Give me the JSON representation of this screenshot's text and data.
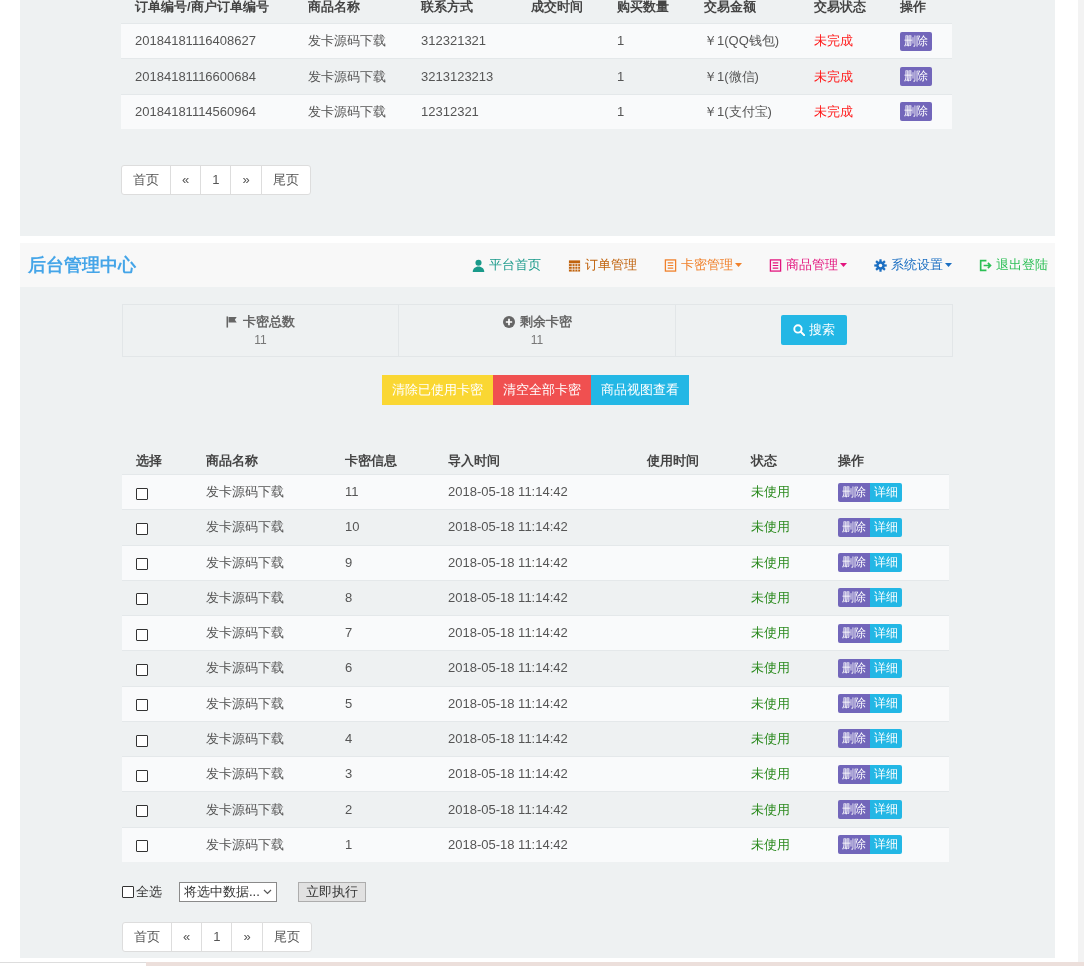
{
  "orders_table": {
    "columns": [
      "订单编号/商户订单编号",
      "商品名称",
      "联系方式",
      "成交时间",
      "购买数量",
      "交易金额",
      "交易状态",
      "操作"
    ],
    "rows": [
      {
        "order_no": "20184181116408627",
        "product": "发卡源码下载",
        "contact": "312321321",
        "quantity": "1",
        "amount": "￥1(QQ钱包)",
        "status": "未完成",
        "action": "删除"
      },
      {
        "order_no": "20184181116600684",
        "product": "发卡源码下载",
        "contact": "3213123213",
        "quantity": "1",
        "amount": "￥1(微信)",
        "status": "未完成",
        "action": "删除"
      },
      {
        "order_no": "20184181114560964",
        "product": "发卡源码下载",
        "contact": "12312321",
        "quantity": "1",
        "amount": "￥1(支付宝)",
        "status": "未完成",
        "action": "删除"
      }
    ]
  },
  "orders_pagination": [
    "首页",
    "«",
    "1",
    "»",
    "尾页"
  ],
  "navbar": {
    "brand": "后台管理中心",
    "items": [
      {
        "label": "平台首页",
        "color": "#1a9a8a",
        "dropdown": false
      },
      {
        "label": "订单管理",
        "color": "#c0620c",
        "dropdown": false
      },
      {
        "label": "卡密管理",
        "color": "#f0812c",
        "dropdown": true
      },
      {
        "label": "商品管理",
        "color": "#e3157e",
        "dropdown": true
      },
      {
        "label": "系统设置",
        "color": "#1c6fc2",
        "dropdown": true
      },
      {
        "label": "退出登陆",
        "color": "#2cbf55",
        "dropdown": false
      }
    ]
  },
  "stats": [
    {
      "label": "卡密总数",
      "value": "11"
    },
    {
      "label": "剩余卡密",
      "value": "11"
    }
  ],
  "search_button": "搜索",
  "action_buttons": [
    {
      "label": "清除已使用卡密",
      "color": "#fad733"
    },
    {
      "label": "清空全部卡密",
      "color": "#f05050"
    },
    {
      "label": "商品视图查看",
      "color": "#23b7e5"
    }
  ],
  "cards_table": {
    "columns": [
      "选择",
      "商品名称",
      "卡密信息",
      "导入时间",
      "使用时间",
      "状态",
      "操作"
    ],
    "rows": [
      {
        "checked": false,
        "product": "发卡源码下载",
        "card_info": "11",
        "import_time": "2018-05-18 11:14:42",
        "status": "未使用",
        "actions": [
          "删除",
          "详细"
        ]
      },
      {
        "checked": false,
        "product": "发卡源码下载",
        "card_info": "10",
        "import_time": "2018-05-18 11:14:42",
        "status": "未使用",
        "actions": [
          "删除",
          "详细"
        ]
      },
      {
        "checked": false,
        "product": "发卡源码下载",
        "card_info": "9",
        "import_time": "2018-05-18 11:14:42",
        "status": "未使用",
        "actions": [
          "删除",
          "详细"
        ]
      },
      {
        "checked": false,
        "product": "发卡源码下载",
        "card_info": "8",
        "import_time": "2018-05-18 11:14:42",
        "status": "未使用",
        "actions": [
          "删除",
          "详细"
        ]
      },
      {
        "checked": false,
        "product": "发卡源码下载",
        "card_info": "7",
        "import_time": "2018-05-18 11:14:42",
        "status": "未使用",
        "actions": [
          "删除",
          "详细"
        ]
      },
      {
        "checked": false,
        "product": "发卡源码下载",
        "card_info": "6",
        "import_time": "2018-05-18 11:14:42",
        "status": "未使用",
        "actions": [
          "删除",
          "详细"
        ]
      },
      {
        "checked": false,
        "product": "发卡源码下载",
        "card_info": "5",
        "import_time": "2018-05-18 11:14:42",
        "status": "未使用",
        "actions": [
          "删除",
          "详细"
        ]
      },
      {
        "checked": false,
        "product": "发卡源码下载",
        "card_info": "4",
        "import_time": "2018-05-18 11:14:42",
        "status": "未使用",
        "actions": [
          "删除",
          "详细"
        ]
      },
      {
        "checked": false,
        "product": "发卡源码下载",
        "card_info": "3",
        "import_time": "2018-05-18 11:14:42",
        "status": "未使用",
        "actions": [
          "删除",
          "详细"
        ]
      },
      {
        "checked": false,
        "product": "发卡源码下载",
        "card_info": "2",
        "import_time": "2018-05-18 11:14:42",
        "status": "未使用",
        "actions": [
          "删除",
          "详细"
        ]
      },
      {
        "checked": false,
        "product": "发卡源码下载",
        "card_info": "1",
        "import_time": "2018-05-18 11:14:42",
        "status": "未使用",
        "actions": [
          "删除",
          "详细"
        ]
      }
    ]
  },
  "bulk_actions": {
    "select_all": {
      "label": "全选",
      "checked": false
    },
    "select_value": "将选中数据...",
    "execute_button": "立即执行"
  },
  "cards_pagination": [
    "首页",
    "«",
    "1",
    "»",
    "尾页"
  ]
}
